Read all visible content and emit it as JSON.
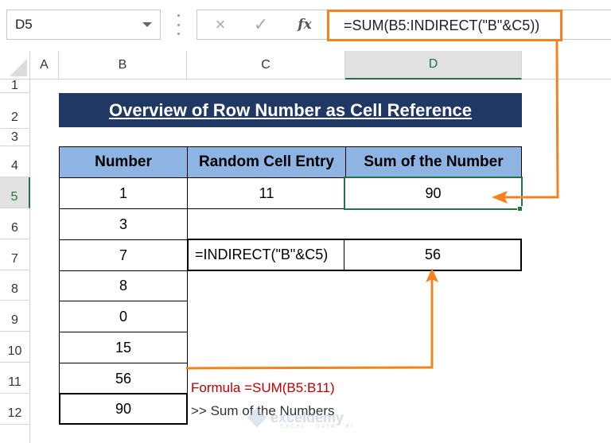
{
  "name_box": {
    "value": "D5"
  },
  "formula_bar": {
    "cancel_icon": "×",
    "enter_icon": "✓",
    "fx_label": "fx",
    "formula": "=SUM(B5:INDIRECT(\"B\"&C5))"
  },
  "columns": [
    "A",
    "B",
    "C",
    "D"
  ],
  "selected_column": "D",
  "rows": [
    "1",
    "2",
    "3",
    "4",
    "5",
    "6",
    "7",
    "8",
    "9",
    "10",
    "11",
    "12"
  ],
  "selected_row": "5",
  "title": "Overview of Row Number as Cell Reference",
  "table": {
    "headers": [
      "Number",
      "Random Cell Entry",
      "Sum of the Number"
    ],
    "numbers": [
      "1",
      "3",
      "7",
      "8",
      "0",
      "15",
      "56",
      "90"
    ],
    "random_cell_entry": "11",
    "sum_of_number": "90"
  },
  "helper": {
    "formula_text": "=INDIRECT(\"B\"&C5)",
    "result": "56"
  },
  "notes": {
    "formula": "Formula =SUM(B5:B11)",
    "description": ">> Sum of the Numbers"
  },
  "watermark": {
    "brand": "exceldemy",
    "tagline": "EXCEL · DATA · BI"
  },
  "colors": {
    "banner": "#203864",
    "header_fill": "#8eb4e3",
    "selection": "#217346",
    "arrow": "#f5821f",
    "note_red": "#c00000"
  }
}
